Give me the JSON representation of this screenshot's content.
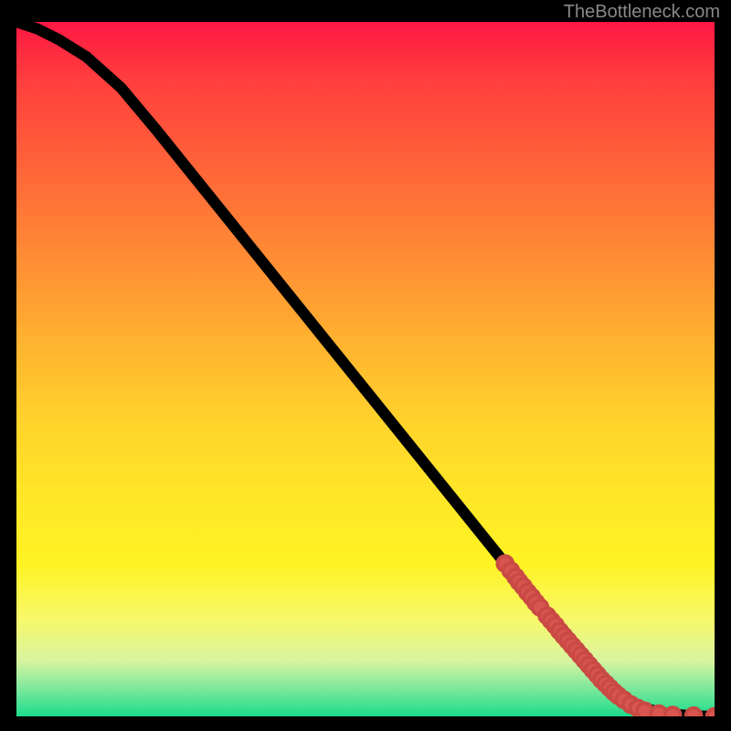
{
  "watermark": "TheBottleneck.com",
  "chart_data": {
    "type": "line",
    "title": "",
    "xlabel": "",
    "ylabel": "",
    "xlim": [
      0,
      100
    ],
    "ylim": [
      0,
      100
    ],
    "curve": {
      "name": "bottleneck-curve",
      "x": [
        0,
        3,
        6,
        10,
        15,
        20,
        30,
        40,
        50,
        60,
        70,
        78,
        82,
        84,
        86,
        88,
        90,
        92,
        94,
        96,
        98,
        100
      ],
      "y": [
        100,
        99,
        97.5,
        95,
        90.5,
        84.5,
        72,
        59.5,
        47,
        34.5,
        22,
        12,
        7,
        4.8,
        3.2,
        2.0,
        1.2,
        0.6,
        0.3,
        0.15,
        0.05,
        0
      ]
    },
    "points": {
      "name": "data-points",
      "x": [
        70,
        70.8,
        71.5,
        72,
        72.6,
        73.2,
        73.8,
        74.4,
        75,
        76,
        76.6,
        77.2,
        77.8,
        78.4,
        79,
        79.6,
        80.2,
        80.8,
        81.4,
        82,
        82.6,
        83.2,
        83.8,
        84.4,
        85,
        85.6,
        86.2,
        87,
        88,
        89,
        90,
        92,
        94,
        97,
        100
      ],
      "y": [
        22,
        21,
        20.1,
        19.4,
        18.7,
        17.9,
        17.2,
        16.4,
        15.7,
        14.5,
        13.8,
        13.1,
        12.3,
        11.6,
        10.9,
        10.2,
        9.5,
        8.8,
        8.1,
        7.4,
        6.7,
        6.0,
        5.3,
        4.7,
        4.1,
        3.5,
        3.0,
        2.4,
        1.7,
        1.2,
        0.8,
        0.4,
        0.2,
        0.1,
        0
      ]
    },
    "colors": {
      "curve": "#000000",
      "points": "#d9554f",
      "gradient_top": "#ff1744",
      "gradient_bottom": "#1bdc8b"
    }
  }
}
